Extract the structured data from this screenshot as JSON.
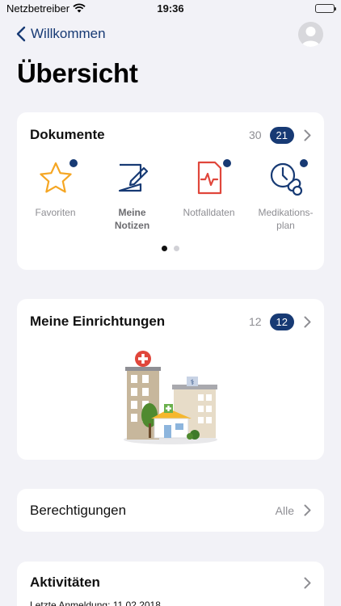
{
  "status_bar": {
    "carrier": "Netzbetreiber",
    "time": "19:36"
  },
  "nav": {
    "back_label": "Willkommen"
  },
  "page": {
    "title": "Übersicht"
  },
  "documents": {
    "title": "Dokumente",
    "count": "30",
    "badge": "21",
    "items": [
      {
        "label": "Favoriten",
        "icon": "star-icon"
      },
      {
        "label": "Meine\nNotizen",
        "icon": "notes-icon"
      },
      {
        "label": "Notfalldaten",
        "icon": "emergency-data-icon"
      },
      {
        "label": "Medikations-\nplan",
        "icon": "medication-plan-icon"
      }
    ]
  },
  "facilities": {
    "title": "Meine Einrichtungen",
    "count": "12",
    "badge": "12"
  },
  "permissions": {
    "title": "Berechtigungen",
    "value": "Alle"
  },
  "activities": {
    "title": "Aktivitäten",
    "last_login": "Letzte Anmeldung: 11.02.2018"
  },
  "colors": {
    "accent": "#173a74",
    "background": "#f2f2f7",
    "icon_orange": "#f5a623",
    "icon_red": "#e0463b"
  }
}
